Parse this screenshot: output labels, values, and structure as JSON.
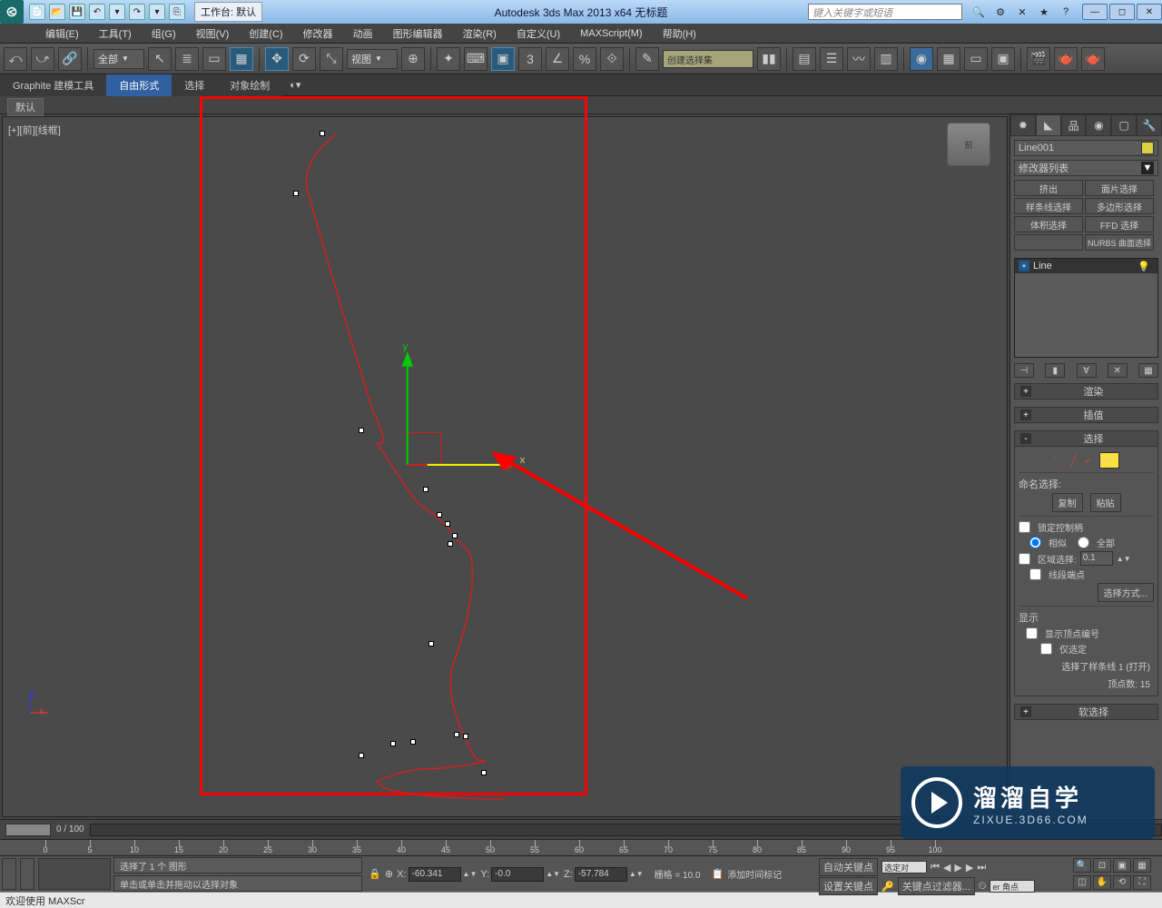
{
  "titlebar": {
    "workspace_label": "工作台: 默认",
    "app_title": "Autodesk 3ds Max  2013 x64     无标题",
    "search_placeholder": "键入关键字或短语"
  },
  "menu": {
    "items": [
      "编辑(E)",
      "工具(T)",
      "组(G)",
      "视图(V)",
      "创建(C)",
      "修改器",
      "动画",
      "图形编辑器",
      "渲染(R)",
      "自定义(U)",
      "MAXScript(M)",
      "帮助(H)"
    ]
  },
  "toolbar": {
    "sel_filter": "全部",
    "view_combo": "视图",
    "named_sel": "创建选择集"
  },
  "ribbon": {
    "tabs": [
      "Graphite 建模工具",
      "自由形式",
      "选择",
      "对象绘制"
    ],
    "active": 1,
    "default_label": "默认"
  },
  "viewport": {
    "label": "[+][前][线框]",
    "viewcube": "前",
    "gizmo_x": "x",
    "gizmo_y": "y",
    "axis_z": "z",
    "axis_x": "x"
  },
  "cmdpanel": {
    "object_name": "Line001",
    "modifier_list": "修改器列表",
    "preset_buttons": [
      "挤出",
      "面片选择",
      "样条线选择",
      "多边形选择",
      "体积选择",
      "FFD 选择",
      "",
      "NURBS 曲面选择"
    ],
    "stack_item": "Line",
    "rollouts": {
      "render": "渲染",
      "interp": "插值",
      "selection": "选择",
      "soft": "软选择"
    },
    "sel_named": "命名选择:",
    "copy": "复制",
    "paste": "粘贴",
    "lock_handles": "锁定控制柄",
    "similar": "相似",
    "all": "全部",
    "area_sel": "区域选择:",
    "area_val": "0.1",
    "seg_end": "线段端点",
    "sel_method": "选择方式...",
    "display": "显示",
    "show_vert_num": "显示顶点编号",
    "only_sel": "仅选定",
    "status1": "选择了样条线 1 (打开)",
    "status2": "顶点数: 15"
  },
  "timeline": {
    "range": "0 / 100"
  },
  "ruler": {
    "ticks": [
      0,
      5,
      10,
      15,
      20,
      25,
      30,
      35,
      40,
      45,
      50,
      55,
      60,
      65,
      70,
      75,
      80,
      85,
      90,
      95,
      100
    ]
  },
  "statusbar": {
    "msg1": "选择了 1 个 图形",
    "msg2": "单击或单击并拖动以选择对象",
    "x_label": "X:",
    "x_val": "-60.341",
    "y_label": "Y:",
    "y_val": "-0.0",
    "z_label": "Z:",
    "z_val": "-57.784",
    "grid": "栅格 = 10.0",
    "addtime": "添加时间标记",
    "autokey": "自动关键点",
    "selkey": "选定对",
    "setkey": "设置关键点",
    "keyfilter": "关键点过滤器...",
    "corner": "er 角点"
  },
  "bottominfo": {
    "welcome": "欢迎使用   MAXScr"
  },
  "watermark": {
    "t1": "溜溜自学",
    "t2": "ZIXUE.3D66.COM"
  }
}
